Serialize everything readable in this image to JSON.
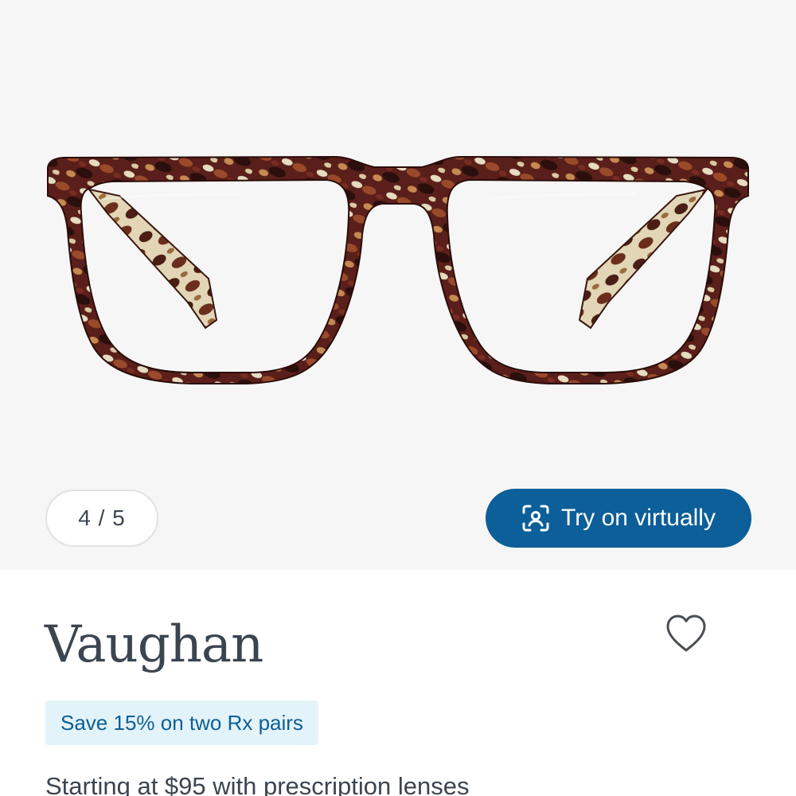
{
  "gallery": {
    "counter": "4 / 5",
    "try_on_label": "Try on virtually",
    "try_on_icon": "face-scan-icon"
  },
  "product": {
    "name": "Vaughan",
    "favorite_icon": "heart-outline-icon",
    "promo": "Save 15% on two Rx pairs",
    "price_text": "Starting at $95 with prescription lenses"
  },
  "colors": {
    "accent": "#0c5f98",
    "text": "#3b4550",
    "promo_bg": "#e3f3fa",
    "promo_text": "#0d5f94",
    "gallery_bg": "#f6f6f6"
  }
}
